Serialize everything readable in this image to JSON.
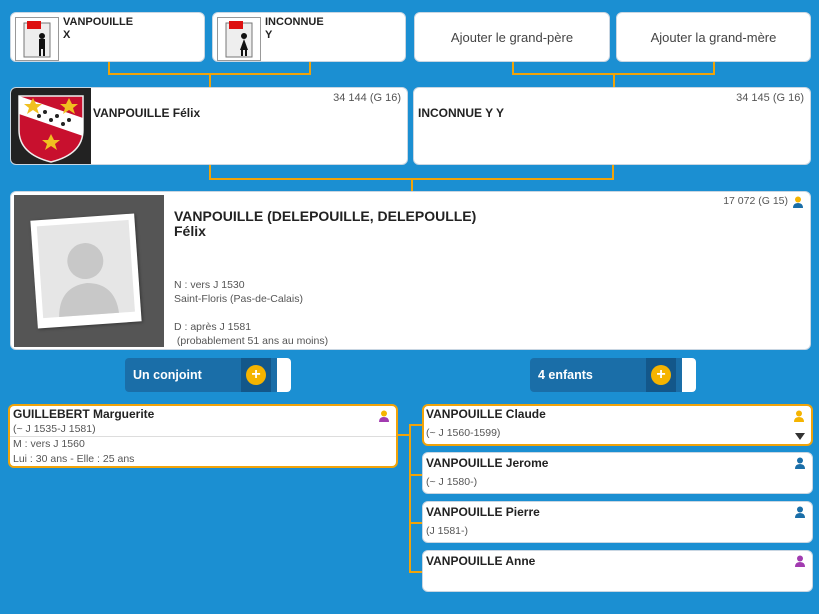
{
  "grandparents": [
    {
      "name": "VANPOUILLE",
      "given": "X",
      "gender": "male"
    },
    {
      "name": "INCONNUE",
      "given": "Y",
      "gender": "female"
    }
  ],
  "add_grandfather": "Ajouter le grand-père",
  "add_grandmother": "Ajouter la grand-mère",
  "father": {
    "name": "VANPOUILLE Félix",
    "sosa": "34 144 (G 16)"
  },
  "mother": {
    "name": "INCONNUE Y Y",
    "sosa": "34 145 (G 16)"
  },
  "main": {
    "surname": "VANPOUILLE (DELEPOUILLE, DELEPOULLE)",
    "given": "Félix",
    "sosa": "17 072 (G 15)",
    "birth": "N : vers J 1530",
    "birth_place": "Saint-Floris (Pas-de-Calais)",
    "death": "D : après J 1581",
    "death_note": " (probablement 51 ans au moins)"
  },
  "spouse_pill": "Un conjoint",
  "children_pill": "4 enfants",
  "spouse": {
    "name": "GUILLEBERT Marguerite",
    "dates": "(~ J 1535-J 1581)",
    "marriage": "M : vers J 1560",
    "ages": "Lui : 30 ans - Elle : 25 ans"
  },
  "children": [
    {
      "name": "VANPOUILLE Claude",
      "dates": "(~ J 1560-1599)",
      "gender": "yellow"
    },
    {
      "name": "VANPOUILLE Jerome",
      "dates": "(~ J 1580-)",
      "gender": "male"
    },
    {
      "name": "VANPOUILLE Pierre",
      "dates": "(J 1581-)",
      "gender": "male"
    },
    {
      "name": "VANPOUILLE Anne",
      "dates": "",
      "gender": "female"
    }
  ],
  "colors": {
    "background": "#1b8fd2",
    "connector": "#f0a30a",
    "pill": "#1a6ea8",
    "plus": "#f5b400"
  }
}
